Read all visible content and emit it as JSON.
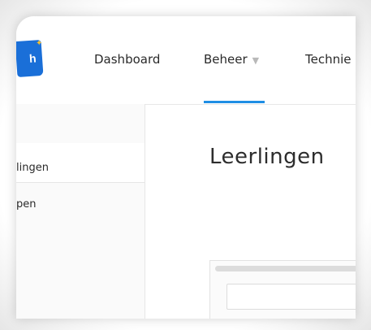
{
  "nav": {
    "dashboard": "Dashboard",
    "beheer": "Beheer",
    "techniek": "Technie"
  },
  "sidebar": {
    "items": [
      {
        "label": ""
      },
      {
        "label": "lingen"
      },
      {
        "label": "pen"
      }
    ]
  },
  "main": {
    "title": "Leerlingen"
  },
  "colors": {
    "accent": "#1f8ee4",
    "logo": "#1a6fd8"
  },
  "icons": {
    "logo": "school-logo-icon",
    "caret": "caret-down-icon"
  }
}
